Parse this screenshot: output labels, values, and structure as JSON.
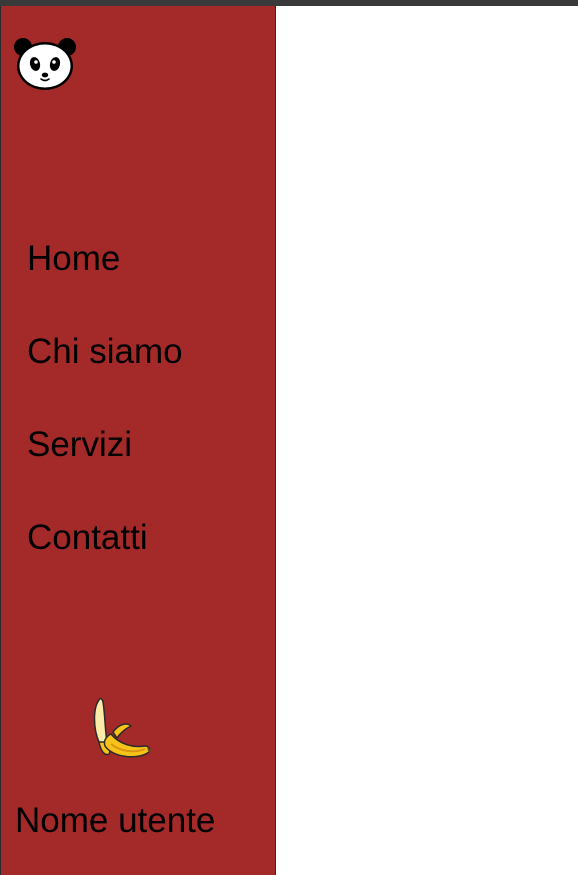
{
  "colors": {
    "sidebar_bg": "#a32a28",
    "top_strip": "#3a3a3a",
    "main_bg": "#ffffff",
    "text": "#000000"
  },
  "sidebar": {
    "logo_icon": "panda-icon",
    "nav": {
      "items": [
        {
          "label": "Home"
        },
        {
          "label": "Chi siamo"
        },
        {
          "label": "Servizi"
        },
        {
          "label": "Contatti"
        }
      ]
    },
    "user": {
      "avatar_icon": "banana-icon",
      "name": "Nome utente"
    }
  }
}
